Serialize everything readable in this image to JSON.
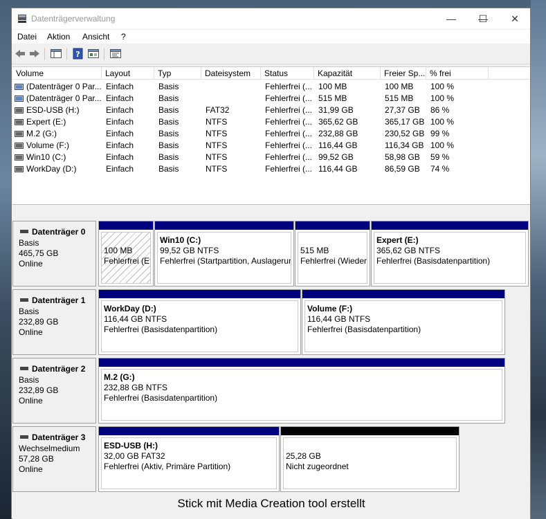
{
  "window": {
    "title": "Datenträgerverwaltung",
    "minimize": "—",
    "maximize": "☐",
    "close": "✕"
  },
  "menu": [
    "Datei",
    "Aktion",
    "Ansicht",
    "?"
  ],
  "toolbar": [
    "back-icon",
    "forward-icon",
    "console-tree-icon",
    "help-icon",
    "properties-icon",
    "settings-icon"
  ],
  "columns": [
    "Volume",
    "Layout",
    "Typ",
    "Dateisystem",
    "Status",
    "Kapazität",
    "Freier Sp...",
    "% frei"
  ],
  "volumes": [
    [
      "(Datenträger 0 Par...",
      "Einfach",
      "Basis",
      "",
      "Fehlerfrei (...",
      "100 MB",
      "100 MB",
      "100 %"
    ],
    [
      "(Datenträger 0 Par...",
      "Einfach",
      "Basis",
      "",
      "Fehlerfrei (...",
      "515 MB",
      "515 MB",
      "100 %"
    ],
    [
      "ESD-USB (H:)",
      "Einfach",
      "Basis",
      "FAT32",
      "Fehlerfrei (...",
      "31,99 GB",
      "27,37 GB",
      "86 %"
    ],
    [
      "Expert (E:)",
      "Einfach",
      "Basis",
      "NTFS",
      "Fehlerfrei (...",
      "365,62 GB",
      "365,17 GB",
      "100 %"
    ],
    [
      "M.2 (G:)",
      "Einfach",
      "Basis",
      "NTFS",
      "Fehlerfrei (...",
      "232,88 GB",
      "230,52 GB",
      "99 %"
    ],
    [
      "Volume (F:)",
      "Einfach",
      "Basis",
      "NTFS",
      "Fehlerfrei (...",
      "116,44 GB",
      "116,34 GB",
      "100 %"
    ],
    [
      "Win10 (C:)",
      "Einfach",
      "Basis",
      "NTFS",
      "Fehlerfrei (...",
      "99,52 GB",
      "58,98 GB",
      "59 %"
    ],
    [
      "WorkDay (D:)",
      "Einfach",
      "Basis",
      "NTFS",
      "Fehlerfrei (...",
      "116,44 GB",
      "86,59 GB",
      "74 %"
    ]
  ],
  "disks": [
    {
      "name": "Datenträger 0",
      "type": "Basis",
      "size": "465,75 GB",
      "state": "Online",
      "partitions": [
        {
          "name": "",
          "size": "100 MB",
          "status": "Fehlerfrei (EFI"
        },
        {
          "name": "Win10  (C:)",
          "size": "99,52 GB NTFS",
          "status": "Fehlerfrei (Startpartition, Auslagerun"
        },
        {
          "name": "",
          "size": "515 MB",
          "status": "Fehlerfrei (Wieder"
        },
        {
          "name": "Expert  (E:)",
          "size": "365,62 GB NTFS",
          "status": "Fehlerfrei (Basisdatenpartition)"
        }
      ]
    },
    {
      "name": "Datenträger 1",
      "type": "Basis",
      "size": "232,89 GB",
      "state": "Online",
      "partitions": [
        {
          "name": "WorkDay  (D:)",
          "size": "116,44 GB NTFS",
          "status": "Fehlerfrei (Basisdatenpartition)"
        },
        {
          "name": "Volume  (F:)",
          "size": "116,44 GB NTFS",
          "status": "Fehlerfrei (Basisdatenpartition)"
        }
      ]
    },
    {
      "name": "Datenträger 2",
      "type": "Basis",
      "size": "232,89 GB",
      "state": "Online",
      "partitions": [
        {
          "name": "M.2  (G:)",
          "size": "232,88 GB NTFS",
          "status": "Fehlerfrei (Basisdatenpartition)"
        }
      ]
    },
    {
      "name": "Datenträger 3",
      "type": "Wechselmedium",
      "size": "57,28 GB",
      "state": "Online",
      "partitions": [
        {
          "name": "ESD-USB  (H:)",
          "size": "32,00 GB FAT32",
          "status": "Fehlerfrei (Aktiv, Primäre Partition)"
        },
        {
          "name": "",
          "size": "25,28 GB",
          "status": "Nicht zugeordnet"
        }
      ]
    }
  ],
  "caption": "Stick mit Media Creation tool erstellt",
  "colors": {
    "primary_partition": "#00007f",
    "unallocated": "#000000",
    "window_bg": "#f0f0f0"
  }
}
